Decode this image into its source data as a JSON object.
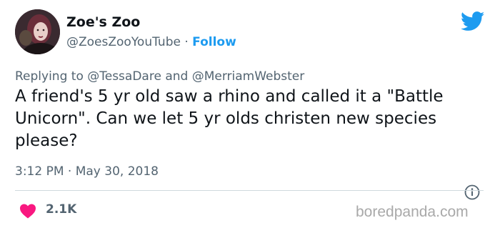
{
  "author": {
    "name": "Zoe's Zoo",
    "handle": "@ZoesZooYouTube",
    "separator": "·",
    "follow_label": "Follow"
  },
  "reply": {
    "prefix": "Replying to",
    "mention1": "@TessaDare",
    "conjunction": "and",
    "mention2": "@MerriamWebster"
  },
  "tweet": {
    "text": "A friend's 5 yr old saw a rhino and called it a \"Battle Unicorn\". Can we let 5 yr olds christen new species please?",
    "time": "3:12 PM",
    "date_separator": "·",
    "date": "May 30, 2018"
  },
  "engagement": {
    "likes": "2.1K"
  },
  "watermark": {
    "text": "boredpanda.com"
  },
  "icons": {
    "logo": "twitter-bird-icon",
    "info": "info-icon",
    "like": "heart-icon"
  },
  "colors": {
    "accent": "#1d9bf0",
    "like": "#f91880",
    "text": "#0f1419",
    "secondary": "#536471",
    "watermark": "#a9a9a9"
  }
}
